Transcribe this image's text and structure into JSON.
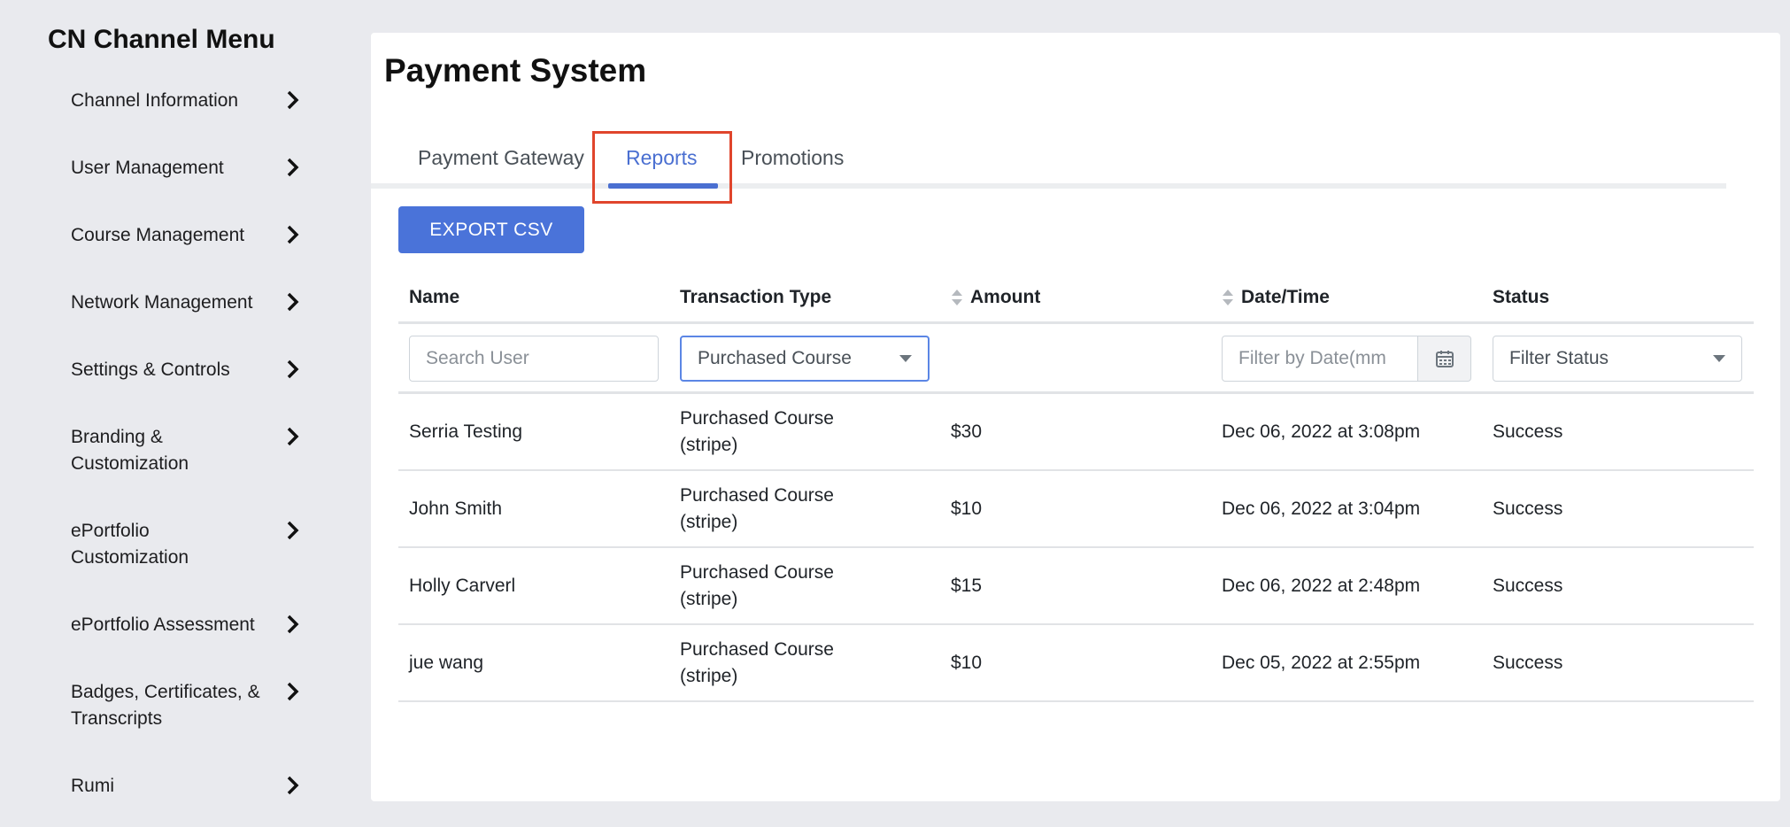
{
  "sidebar": {
    "title": "CN Channel Menu",
    "items": [
      {
        "label": "Channel Information"
      },
      {
        "label": "User Management"
      },
      {
        "label": "Course Management"
      },
      {
        "label": "Network Management"
      },
      {
        "label": "Settings & Controls"
      },
      {
        "label": "Branding & Customization"
      },
      {
        "label": "ePortfolio Customization"
      },
      {
        "label": "ePortfolio Assessment"
      },
      {
        "label": "Badges, Certificates, & Transcripts"
      },
      {
        "label": "Rumi"
      }
    ]
  },
  "main": {
    "title": "Payment System",
    "tabs": [
      {
        "label": "Payment Gateway"
      },
      {
        "label": "Reports"
      },
      {
        "label": "Promotions"
      }
    ],
    "active_tab": "Reports",
    "export_label": "EXPORT CSV",
    "table": {
      "columns": [
        "Name",
        "Transaction Type",
        "Amount",
        "Date/Time",
        "Status"
      ],
      "filters": {
        "name_placeholder": "Search User",
        "type_selected": "Purchased Course",
        "date_placeholder": "Filter by Date(mm",
        "status_placeholder": "Filter Status"
      },
      "rows": [
        {
          "name": "Serria Testing",
          "type_line1": "Purchased Course",
          "type_line2": "(stripe)",
          "amount": "$30",
          "datetime": "Dec 06, 2022 at 3:08pm",
          "status": "Success"
        },
        {
          "name": "John Smith",
          "type_line1": "Purchased Course",
          "type_line2": "(stripe)",
          "amount": "$10",
          "datetime": "Dec 06, 2022 at 3:04pm",
          "status": "Success"
        },
        {
          "name": "Holly Carverl",
          "type_line1": "Purchased Course",
          "type_line2": "(stripe)",
          "amount": "$15",
          "datetime": "Dec 06, 2022 at 2:48pm",
          "status": "Success"
        },
        {
          "name": "jue wang",
          "type_line1": "Purchased Course",
          "type_line2": "(stripe)",
          "amount": "$10",
          "datetime": "Dec 05, 2022 at 2:55pm",
          "status": "Success"
        }
      ]
    }
  },
  "colors": {
    "accent": "#4a73d9",
    "highlight": "#e0452c",
    "background": "#e9eaee"
  },
  "icons": {
    "chevron": "chevron-right-icon",
    "sort": "sort-icon",
    "calendar": "calendar-icon",
    "caret": "caret-down-icon"
  }
}
